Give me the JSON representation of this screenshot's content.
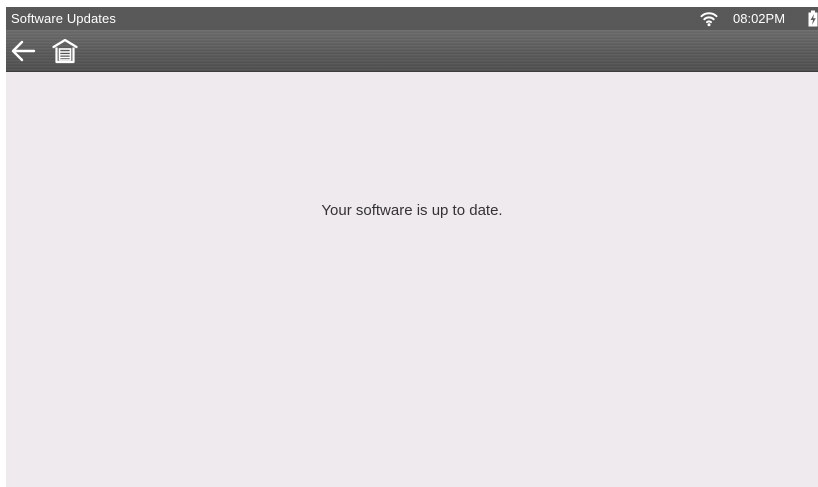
{
  "status_bar": {
    "title": "Software Updates",
    "time": "08:02PM",
    "icons": [
      "wifi-icon",
      "battery-charging-icon"
    ]
  },
  "toolbar": {
    "buttons": [
      {
        "icon": "back-arrow-icon"
      },
      {
        "icon": "home-garage-icon"
      }
    ]
  },
  "content": {
    "message": "Your software is up to date."
  },
  "colors": {
    "status_bar_bg": "#5a5a5a",
    "toolbar_bg": "#5e5e5e",
    "content_bg": "#efeaee",
    "text": "#333333"
  }
}
